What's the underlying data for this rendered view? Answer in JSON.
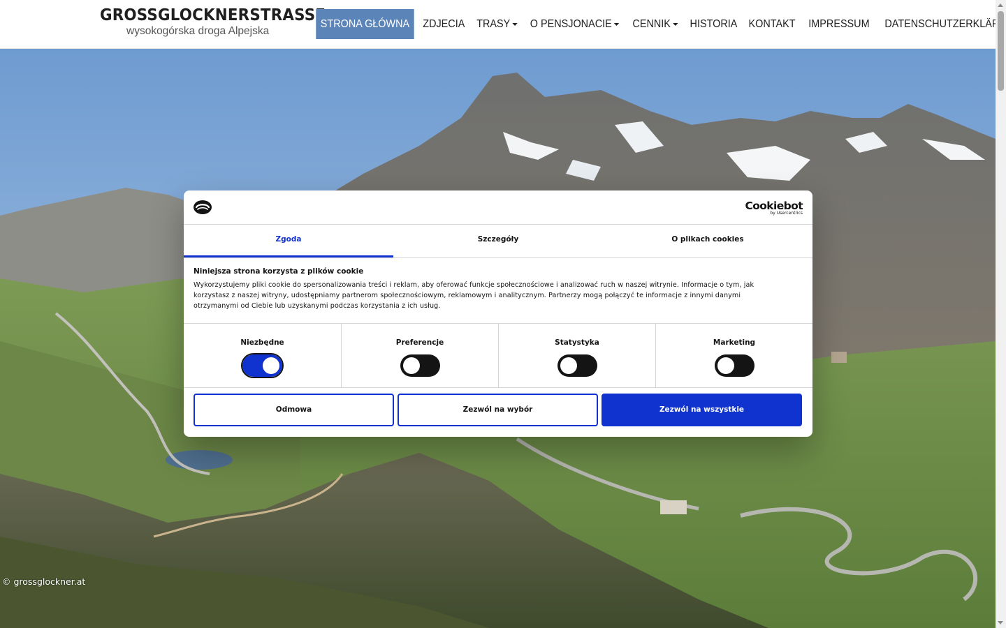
{
  "site": {
    "logo_title": "GROSSGLOCKNERSTRASSE",
    "logo_subtitle": "wysokogórska droga Alpejska"
  },
  "nav": {
    "items": [
      {
        "label": "STRONA GŁÓWNA",
        "active": true,
        "dropdown": false
      },
      {
        "label": "ZDJECIA",
        "active": false,
        "dropdown": false
      },
      {
        "label": "TRASY",
        "active": false,
        "dropdown": true
      },
      {
        "label": "O PENSJONACIE",
        "active": false,
        "dropdown": true
      },
      {
        "label": "CENNIK",
        "active": false,
        "dropdown": true
      },
      {
        "label": "HISTORIA",
        "active": false,
        "dropdown": false
      },
      {
        "label": "KONTAKT",
        "active": false,
        "dropdown": false
      },
      {
        "label": "IMPRESSUM",
        "active": false,
        "dropdown": false
      },
      {
        "label": "DATENSCHUTZERKLÄRUNG",
        "active": false,
        "dropdown": false
      }
    ]
  },
  "hero": {
    "copyright": "© grossglockner.at"
  },
  "cookie_dialog": {
    "brand": "Cookiebot",
    "brand_by": "by Usercentrics",
    "tabs": [
      {
        "label": "Zgoda",
        "active": true
      },
      {
        "label": "Szczegóły",
        "active": false
      },
      {
        "label": "O plikach cookies",
        "active": false
      }
    ],
    "heading": "Niniejsza strona korzysta z plików cookie",
    "text_lines": [
      "Wykorzystujemy pliki cookie do spersonalizowania treści i reklam, aby oferować funkcje społecznościowe i analizować ruch w naszej witrynie. Informacje o tym, jak",
      "korzystasz z naszej witryny, udostępniamy partnerom społecznościowym, reklamowym i analitycznym. Partnerzy mogą połączyć te informacje z innymi danymi",
      "otrzymanymi od Ciebie lub uzyskanymi podczas korzystania z ich usług."
    ],
    "categories": [
      {
        "label": "Niezbędne",
        "enabled": true
      },
      {
        "label": "Preferencje",
        "enabled": false
      },
      {
        "label": "Statystyka",
        "enabled": false
      },
      {
        "label": "Marketing",
        "enabled": false
      }
    ],
    "buttons": {
      "deny": "Odmowa",
      "allow_selection": "Zezwól na wybór",
      "allow_all": "Zezwól na wszystkie"
    },
    "accent_color": "#1032cf"
  },
  "colors": {
    "nav_active_bg": "#5b84b9",
    "sky": "#7fa7d6"
  }
}
